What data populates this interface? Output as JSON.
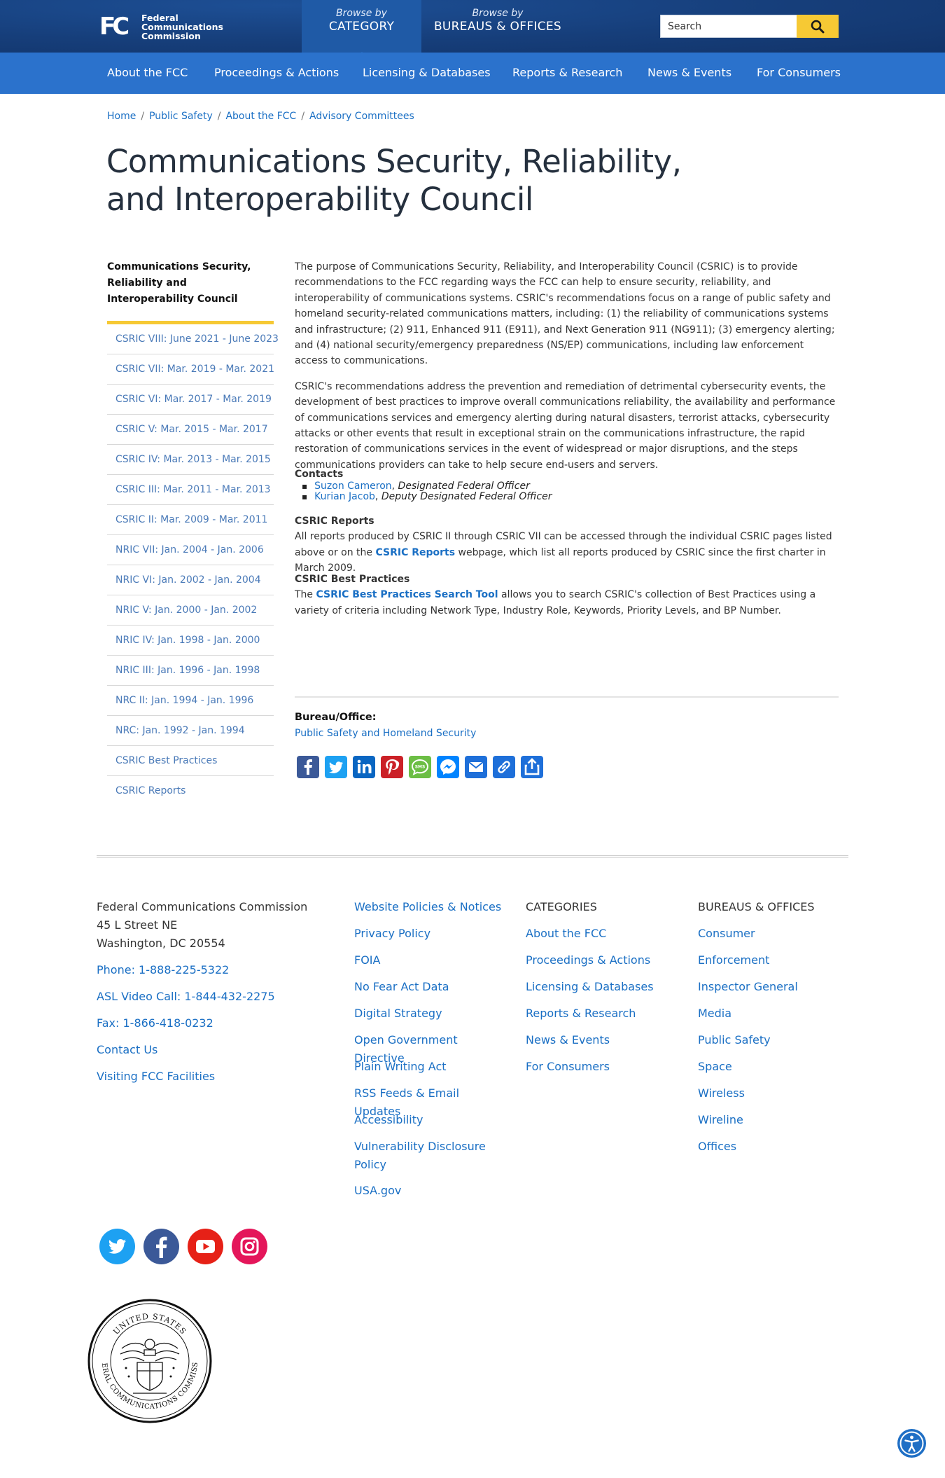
{
  "header": {
    "logo_line1": "Federal",
    "logo_line2": "Communications",
    "logo_line3": "Commission",
    "browse_category_small": "Browse by",
    "browse_category_big": "CATEGORY",
    "browse_bureaus_small": "Browse by",
    "browse_bureaus_big": "BUREAUS & OFFICES",
    "search_placeholder": "Search",
    "accent_color": "#f6c934"
  },
  "nav": {
    "items": [
      "About the FCC",
      "Proceedings & Actions",
      "Licensing & Databases",
      "Reports & Research",
      "News & Events",
      "For Consumers"
    ]
  },
  "breadcrumb": [
    "Home",
    "Public Safety",
    "About the FCC",
    "Advisory Committees"
  ],
  "page_title": "Communications Security, Reliability, and Interoperability Council",
  "sidebar": {
    "heading": "Communications Security, Reliability and Interoperability Council",
    "items": [
      "CSRIC VIII: June 2021 - June 2023",
      "CSRIC VII: Mar. 2019 - Mar. 2021",
      "CSRIC VI: Mar. 2017 - Mar. 2019",
      "CSRIC V: Mar. 2015 - Mar. 2017",
      "CSRIC IV: Mar. 2013 - Mar. 2015",
      "CSRIC III: Mar. 2011 - Mar. 2013",
      "CSRIC II: Mar. 2009 - Mar. 2011",
      "NRIC VII: Jan. 2004 - Jan. 2006",
      "NRIC VI: Jan. 2002 - Jan. 2004",
      "NRIC V: Jan. 2000 - Jan. 2002",
      "NRIC IV: Jan. 1998 - Jan. 2000",
      "NRIC III: Jan. 1996 - Jan. 1998",
      "NRC II: Jan. 1994 - Jan. 1996",
      "NRC: Jan. 1992 - Jan. 1994",
      "CSRIC Best Practices",
      "CSRIC Reports"
    ]
  },
  "main": {
    "para1": "The purpose of Communications Security, Reliability, and Interoperability Council (CSRIC) is to provide recommendations to the FCC regarding ways the FCC can help to ensure security, reliability, and interoperability of communications systems.  CSRIC's recommendations focus on a range of public safety and homeland security-related communications matters, including: (1) the reliability of communications systems and infrastructure; (2) 911, Enhanced 911 (E911), and Next Generation 911 (NG911); (3) emergency alerting; and (4) national security/emergency preparedness (NS/EP) communications, including law enforcement access to communications.",
    "para2": "CSRIC's recommendations address the prevention and remediation of detrimental cybersecurity events, the development of best practices to improve overall communications reliability, the availability and performance of communications services and emergency alerting during natural disasters, terrorist attacks, cybersecurity attacks or other events that result in exceptional strain on the communications infrastructure, the rapid restoration of communications services in the event of widespread or major disruptions, and the steps communications providers can take to help secure end-users and servers.",
    "contacts_heading": "Contacts",
    "contacts": [
      {
        "name": "Suzon Cameron",
        "role": "Designated Federal Officer"
      },
      {
        "name": "Kurian Jacob",
        "role": "Deputy Designated Federal Officer"
      }
    ],
    "reports_heading": "CSRIC Reports",
    "reports_pre": "All reports produced by CSRIC II through CSRIC VII can be accessed through the individual CSRIC pages listed above or on the",
    "reports_link": "CSRIC Reports",
    "reports_post": "webpage, which list all reports produced by CSRIC since the first charter in March 2009.",
    "bp_heading": "CSRIC Best Practices",
    "bp_pre": "The",
    "bp_link": "CSRIC Best Practices Search Tool",
    "bp_post": "allows you to search CSRIC's collection of Best Practices using a variety of criteria including Network Type, Industry Role, Keywords, Priority Levels, and BP Number.",
    "bureau_label": "Bureau/Office:",
    "bureau_link": "Public Safety and Homeland Security"
  },
  "share_icons": [
    {
      "name": "facebook-icon",
      "color": "#3b5998"
    },
    {
      "name": "twitter-icon",
      "color": "#1da1f2"
    },
    {
      "name": "linkedin-icon",
      "color": "#0a66c2"
    },
    {
      "name": "pinterest-icon",
      "color": "#cb2027"
    },
    {
      "name": "sms-icon",
      "color": "#6cbe45"
    },
    {
      "name": "messenger-icon",
      "color": "#0084ff"
    },
    {
      "name": "email-icon",
      "color": "#1e6fd9"
    },
    {
      "name": "copy-link-icon",
      "color": "#1e6fd9"
    },
    {
      "name": "share-icon",
      "color": "#1e6fd9"
    }
  ],
  "footer": {
    "org": "Federal Communications Commission",
    "street": "45 L Street NE",
    "city": "Washington, DC 20554",
    "phone": "Phone: 1-888-225-5322",
    "asl": "ASL Video Call: 1-844-432-2275",
    "fax": "Fax: 1-866-418-0232",
    "contact": "Contact Us",
    "visiting": "Visiting FCC Facilities",
    "policies": [
      "Website Policies & Notices",
      "Privacy Policy",
      "FOIA",
      "No Fear Act Data",
      "Digital Strategy",
      "Open Government Directive",
      "Plain Writing Act",
      "RSS Feeds & Email Updates",
      "Accessibility",
      "Vulnerability Disclosure Policy",
      "USA.gov"
    ],
    "categories_heading": "CATEGORIES",
    "categories": [
      "About the FCC",
      "Proceedings & Actions",
      "Licensing & Databases",
      "Reports & Research",
      "News & Events",
      "For Consumers"
    ],
    "bureaus_heading": "BUREAUS & OFFICES",
    "bureaus": [
      "Consumer",
      "Enforcement",
      "Inspector General",
      "Media",
      "Public Safety",
      "Space",
      "Wireless",
      "Wireline",
      "Offices"
    ],
    "seal_text": "UNITED STATES FEDERAL COMMUNICATIONS COMMISSION"
  },
  "social": [
    {
      "name": "twitter-icon",
      "color": "#1da1f2"
    },
    {
      "name": "facebook-icon",
      "color": "#3b5998"
    },
    {
      "name": "youtube-icon",
      "color": "#e62117"
    },
    {
      "name": "instagram-icon",
      "color": "#e4165a"
    }
  ]
}
